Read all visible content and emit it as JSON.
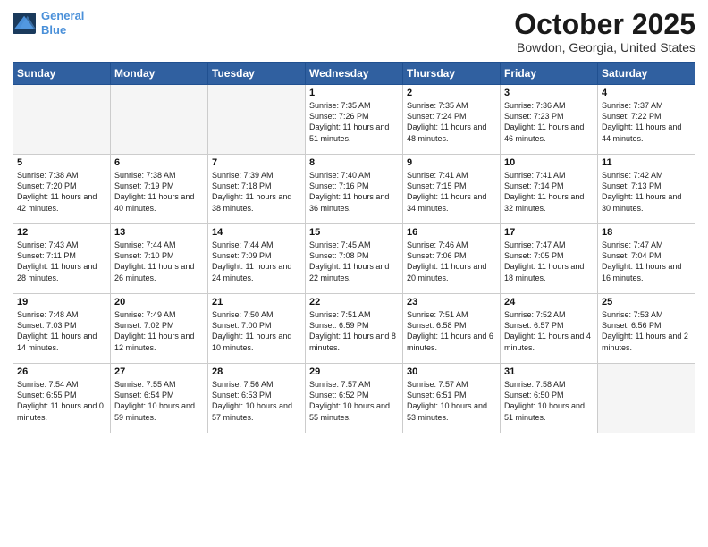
{
  "header": {
    "logo_line1": "General",
    "logo_line2": "Blue",
    "month_title": "October 2025",
    "location": "Bowdon, Georgia, United States"
  },
  "weekdays": [
    "Sunday",
    "Monday",
    "Tuesday",
    "Wednesday",
    "Thursday",
    "Friday",
    "Saturday"
  ],
  "weeks": [
    [
      {
        "day": "",
        "text": ""
      },
      {
        "day": "",
        "text": ""
      },
      {
        "day": "",
        "text": ""
      },
      {
        "day": "1",
        "text": "Sunrise: 7:35 AM\nSunset: 7:26 PM\nDaylight: 11 hours\nand 51 minutes."
      },
      {
        "day": "2",
        "text": "Sunrise: 7:35 AM\nSunset: 7:24 PM\nDaylight: 11 hours\nand 48 minutes."
      },
      {
        "day": "3",
        "text": "Sunrise: 7:36 AM\nSunset: 7:23 PM\nDaylight: 11 hours\nand 46 minutes."
      },
      {
        "day": "4",
        "text": "Sunrise: 7:37 AM\nSunset: 7:22 PM\nDaylight: 11 hours\nand 44 minutes."
      }
    ],
    [
      {
        "day": "5",
        "text": "Sunrise: 7:38 AM\nSunset: 7:20 PM\nDaylight: 11 hours\nand 42 minutes."
      },
      {
        "day": "6",
        "text": "Sunrise: 7:38 AM\nSunset: 7:19 PM\nDaylight: 11 hours\nand 40 minutes."
      },
      {
        "day": "7",
        "text": "Sunrise: 7:39 AM\nSunset: 7:18 PM\nDaylight: 11 hours\nand 38 minutes."
      },
      {
        "day": "8",
        "text": "Sunrise: 7:40 AM\nSunset: 7:16 PM\nDaylight: 11 hours\nand 36 minutes."
      },
      {
        "day": "9",
        "text": "Sunrise: 7:41 AM\nSunset: 7:15 PM\nDaylight: 11 hours\nand 34 minutes."
      },
      {
        "day": "10",
        "text": "Sunrise: 7:41 AM\nSunset: 7:14 PM\nDaylight: 11 hours\nand 32 minutes."
      },
      {
        "day": "11",
        "text": "Sunrise: 7:42 AM\nSunset: 7:13 PM\nDaylight: 11 hours\nand 30 minutes."
      }
    ],
    [
      {
        "day": "12",
        "text": "Sunrise: 7:43 AM\nSunset: 7:11 PM\nDaylight: 11 hours\nand 28 minutes."
      },
      {
        "day": "13",
        "text": "Sunrise: 7:44 AM\nSunset: 7:10 PM\nDaylight: 11 hours\nand 26 minutes."
      },
      {
        "day": "14",
        "text": "Sunrise: 7:44 AM\nSunset: 7:09 PM\nDaylight: 11 hours\nand 24 minutes."
      },
      {
        "day": "15",
        "text": "Sunrise: 7:45 AM\nSunset: 7:08 PM\nDaylight: 11 hours\nand 22 minutes."
      },
      {
        "day": "16",
        "text": "Sunrise: 7:46 AM\nSunset: 7:06 PM\nDaylight: 11 hours\nand 20 minutes."
      },
      {
        "day": "17",
        "text": "Sunrise: 7:47 AM\nSunset: 7:05 PM\nDaylight: 11 hours\nand 18 minutes."
      },
      {
        "day": "18",
        "text": "Sunrise: 7:47 AM\nSunset: 7:04 PM\nDaylight: 11 hours\nand 16 minutes."
      }
    ],
    [
      {
        "day": "19",
        "text": "Sunrise: 7:48 AM\nSunset: 7:03 PM\nDaylight: 11 hours\nand 14 minutes."
      },
      {
        "day": "20",
        "text": "Sunrise: 7:49 AM\nSunset: 7:02 PM\nDaylight: 11 hours\nand 12 minutes."
      },
      {
        "day": "21",
        "text": "Sunrise: 7:50 AM\nSunset: 7:00 PM\nDaylight: 11 hours\nand 10 minutes."
      },
      {
        "day": "22",
        "text": "Sunrise: 7:51 AM\nSunset: 6:59 PM\nDaylight: 11 hours\nand 8 minutes."
      },
      {
        "day": "23",
        "text": "Sunrise: 7:51 AM\nSunset: 6:58 PM\nDaylight: 11 hours\nand 6 minutes."
      },
      {
        "day": "24",
        "text": "Sunrise: 7:52 AM\nSunset: 6:57 PM\nDaylight: 11 hours\nand 4 minutes."
      },
      {
        "day": "25",
        "text": "Sunrise: 7:53 AM\nSunset: 6:56 PM\nDaylight: 11 hours\nand 2 minutes."
      }
    ],
    [
      {
        "day": "26",
        "text": "Sunrise: 7:54 AM\nSunset: 6:55 PM\nDaylight: 11 hours\nand 0 minutes."
      },
      {
        "day": "27",
        "text": "Sunrise: 7:55 AM\nSunset: 6:54 PM\nDaylight: 10 hours\nand 59 minutes."
      },
      {
        "day": "28",
        "text": "Sunrise: 7:56 AM\nSunset: 6:53 PM\nDaylight: 10 hours\nand 57 minutes."
      },
      {
        "day": "29",
        "text": "Sunrise: 7:57 AM\nSunset: 6:52 PM\nDaylight: 10 hours\nand 55 minutes."
      },
      {
        "day": "30",
        "text": "Sunrise: 7:57 AM\nSunset: 6:51 PM\nDaylight: 10 hours\nand 53 minutes."
      },
      {
        "day": "31",
        "text": "Sunrise: 7:58 AM\nSunset: 6:50 PM\nDaylight: 10 hours\nand 51 minutes."
      },
      {
        "day": "",
        "text": ""
      }
    ]
  ]
}
